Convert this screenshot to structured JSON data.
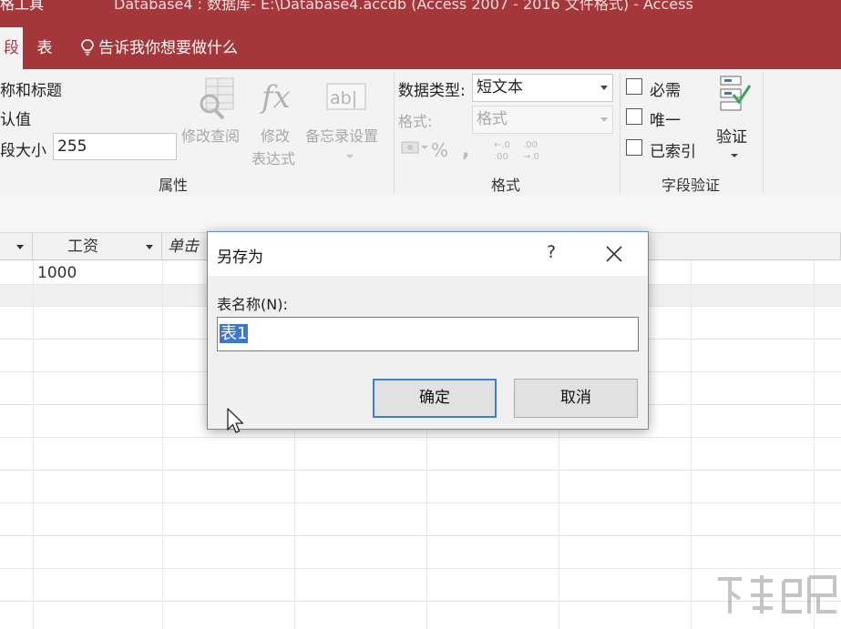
{
  "titlebar": {
    "tools_label": "格工具",
    "window_title": "Database4 : 数据库- E:\\Database4.accdb (Access 2007 - 2016 文件格式) - Access"
  },
  "tabs": [
    {
      "label": "段",
      "active": true
    },
    {
      "label": "表",
      "active": false
    }
  ],
  "tell_me": "告诉我你想要做什么",
  "ribbon": {
    "properties": {
      "name_caption": "称和标题",
      "default_value": "认值",
      "field_size_label": "段大小",
      "field_size_value": "255",
      "modify_lookup": "修改查阅",
      "modify_expression_line1": "修改",
      "modify_expression_line2": "表达式",
      "memo_settings": "备忘录设置",
      "group_label": "属性"
    },
    "formatting": {
      "data_type_label": "数据类型:",
      "data_type_value": "短文本",
      "format_label": "格式:",
      "format_value": "格式",
      "group_label": "格式"
    },
    "validation": {
      "required": "必需",
      "unique": "唯一",
      "indexed": "已索引",
      "validation_button": "验证",
      "group_label": "字段验证"
    }
  },
  "datasheet": {
    "columns": [
      "工资",
      "单击"
    ],
    "rows": [
      [
        "1000"
      ]
    ]
  },
  "dialog": {
    "title": "另存为",
    "help": "?",
    "field_label": "表名称(N):",
    "field_value": "表1",
    "ok_label": "确定",
    "cancel_label": "取消"
  },
  "colors": {
    "accent": "#a4373a",
    "ribbon_bg": "#f3f3f3",
    "selection": "#3a77d1",
    "dialog_border": "#5b8fc9"
  }
}
